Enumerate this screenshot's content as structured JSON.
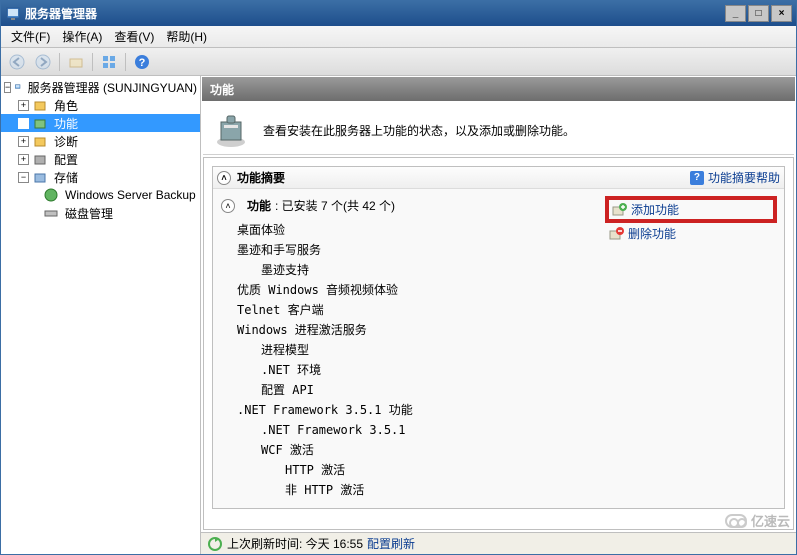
{
  "window": {
    "title": "服务器管理器"
  },
  "menu": {
    "file": "文件(F)",
    "action": "操作(A)",
    "view": "查看(V)",
    "help": "帮助(H)"
  },
  "toolbar": {
    "back": "back",
    "forward": "forward",
    "up": "up",
    "grid": "grid",
    "help": "help"
  },
  "tree": {
    "root": "服务器管理器 (SUNJINGYUAN)",
    "roles": "角色",
    "features": "功能",
    "diagnostics": "诊断",
    "config": "配置",
    "storage": "存储",
    "wsb": "Windows Server Backup",
    "diskmgmt": "磁盘管理"
  },
  "header": {
    "title": "功能"
  },
  "topText": "查看安装在此服务器上功能的状态，以及添加或删除功能。",
  "summary": {
    "section_title": "功能摘要",
    "help_label": "功能摘要帮助",
    "features_label": "功能",
    "installed_text": ": 已安装 7 个(共 42 个)",
    "list": [
      {
        "txt": "桌面体验",
        "ind": 0
      },
      {
        "txt": "墨迹和手写服务",
        "ind": 0
      },
      {
        "txt": "墨迹支持",
        "ind": 1
      },
      {
        "txt": "优质 Windows 音频视频体验",
        "ind": 0
      },
      {
        "txt": "Telnet 客户端",
        "ind": 0
      },
      {
        "txt": "Windows 进程激活服务",
        "ind": 0
      },
      {
        "txt": "进程模型",
        "ind": 1
      },
      {
        "txt": ".NET 环境",
        "ind": 1
      },
      {
        "txt": "配置 API",
        "ind": 1
      },
      {
        "txt": ".NET Framework 3.5.1 功能",
        "ind": 0
      },
      {
        "txt": ".NET Framework 3.5.1",
        "ind": 1
      },
      {
        "txt": "WCF 激活",
        "ind": 1
      },
      {
        "txt": "HTTP 激活",
        "ind": 2
      },
      {
        "txt": "非 HTTP 激活",
        "ind": 2
      }
    ],
    "actions": {
      "add": "添加功能",
      "remove": "删除功能"
    }
  },
  "status": {
    "prefix": "上次刷新时间: 今天 16:55",
    "link": "配置刷新"
  },
  "watermark": "亿速云"
}
